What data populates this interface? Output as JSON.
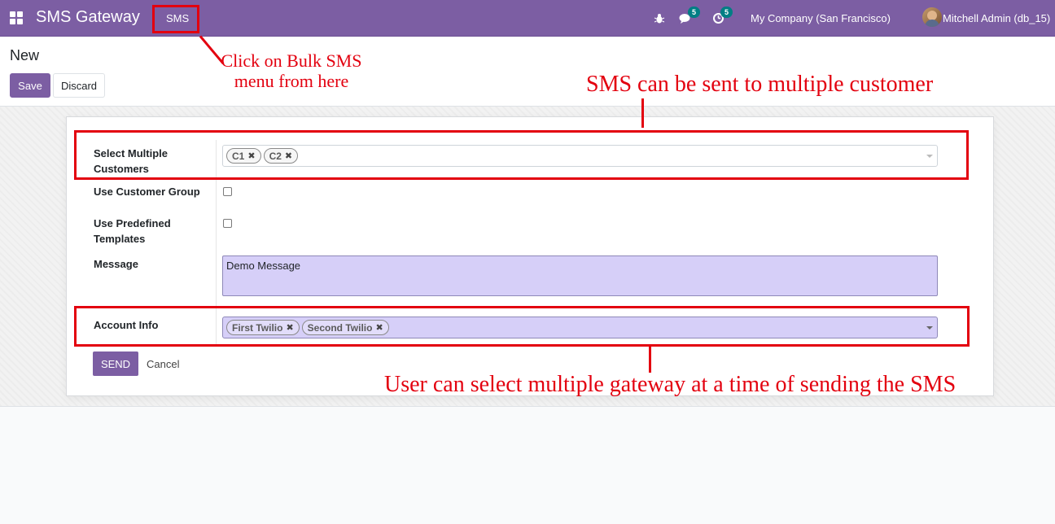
{
  "navbar": {
    "app_title": "SMS Gateway",
    "menu_sms": "SMS",
    "chat_badge": "5",
    "activity_badge": "5",
    "company": "My Company (San Francisco)",
    "user": "Mitchell Admin (db_15)",
    "icons": [
      "apps-icon",
      "bug-icon",
      "chat-icon",
      "activity-clock-icon",
      "avatar"
    ]
  },
  "control_panel": {
    "breadcrumb": "New",
    "save_label": "Save",
    "discard_label": "Discard"
  },
  "form": {
    "customers": {
      "label": "Select Multiple Customers",
      "tags": [
        "C1",
        "C2"
      ]
    },
    "customer_group": {
      "label": "Use Customer Group",
      "checked": false
    },
    "predefined_templates": {
      "label": "Use Predefined Templates",
      "checked": false
    },
    "message": {
      "label": "Message",
      "value": "Demo Message"
    },
    "account_info": {
      "label": "Account Info",
      "tags": [
        "First Twilio",
        "Second Twilio"
      ]
    },
    "send_label": "SEND",
    "cancel_label": "Cancel"
  },
  "annotations": {
    "bulk_sms_line1": "Click on Bulk SMS",
    "bulk_sms_line2": "menu from here",
    "multiple_customer": "SMS can be sent to multiple customer",
    "multiple_gateway": "User can select multiple gateway at a time of sending the SMS",
    "color": "#e3000f"
  },
  "colors": {
    "brand": "#7c5ea3",
    "badge": "#017e84",
    "required_field": "#d6cff8"
  }
}
